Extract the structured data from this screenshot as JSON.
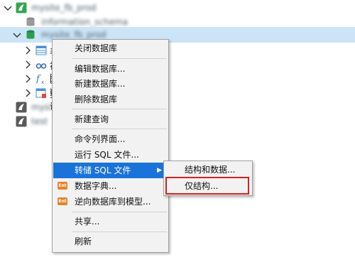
{
  "tree": {
    "root_connection": "mysite_fb_prod",
    "db_info_schema": "information_schema",
    "db_selected": "mysite_fb_prod",
    "child_rows": [
      "表",
      "视图",
      "函数",
      "查询"
    ],
    "other_connections": [
      "mysite",
      "test"
    ]
  },
  "context_menu": {
    "close_db": "关闭数据库",
    "edit_db": "编辑数据库...",
    "new_db": "新建数据库...",
    "delete_db": "删除数据库",
    "new_query": "新建查询",
    "console": "命令列界面...",
    "run_sql": "运行 SQL 文件...",
    "dump_sql": "转储 SQL 文件",
    "data_dict": "数据字典...",
    "reverse_model": "逆向数据库到模型...",
    "share": "共享...",
    "refresh": "刷新",
    "ent_badge": "Ent"
  },
  "submenu": {
    "structure_and_data": "结构和数据...",
    "structure_only": "仅结构..."
  },
  "colors": {
    "highlight": "#1a73d9",
    "selection": "#cce4f7",
    "callout": "#d32222",
    "db_green": "#2e9d4f",
    "conn_green": "#2fa84f"
  }
}
